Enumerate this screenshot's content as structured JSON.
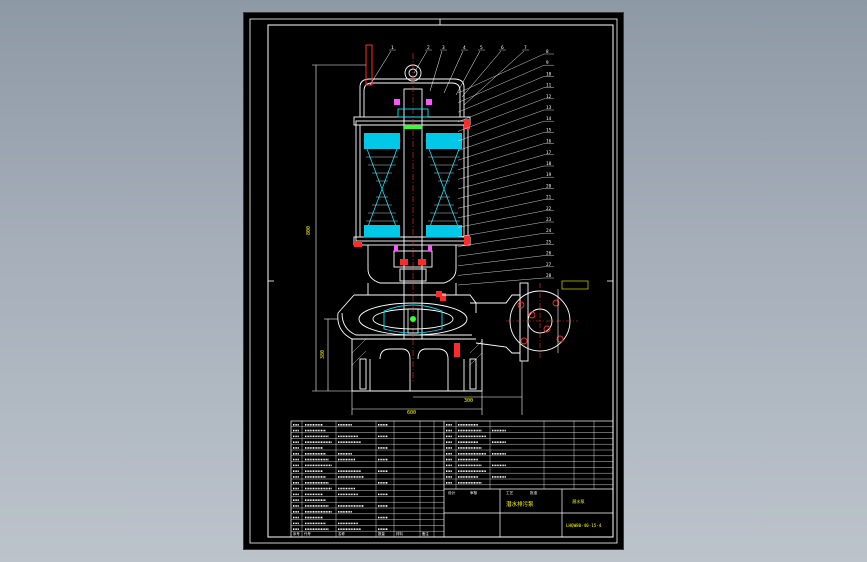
{
  "viewport": {
    "background_color": "#9aa4af",
    "sheet_color": "#000000"
  },
  "drawing": {
    "balloon_numbers_top": [
      "1",
      "2",
      "3",
      "4",
      "5",
      "6",
      "7"
    ],
    "balloon_numbers_right": [
      "8",
      "9",
      "10",
      "11",
      "12",
      "13",
      "14",
      "15",
      "16",
      "17",
      "18",
      "19",
      "20",
      "21",
      "22",
      "23",
      "24",
      "25",
      "26",
      "27",
      "28"
    ],
    "dimension_height": "800",
    "dimension_lower": "380",
    "dimension_width": "600",
    "dimension_offset": "300",
    "colors": {
      "frame": "#ffffff",
      "outline": "#ffffff",
      "cyan": "#00e5ff",
      "red": "#ff2a2a",
      "green": "#33ff33",
      "yellow": "#ffff00",
      "magenta": "#ff55ff",
      "blue": "#4a8cff"
    }
  },
  "title_block": {
    "drawing_title": "潜水排污泵",
    "drawing_number": "LHQW80-40-15-4",
    "left_header": [
      "序号",
      "代号",
      "名称",
      "数量",
      "材料",
      "备注"
    ],
    "scale_labels": [
      "设计",
      "审核",
      "工艺",
      "批准"
    ]
  }
}
